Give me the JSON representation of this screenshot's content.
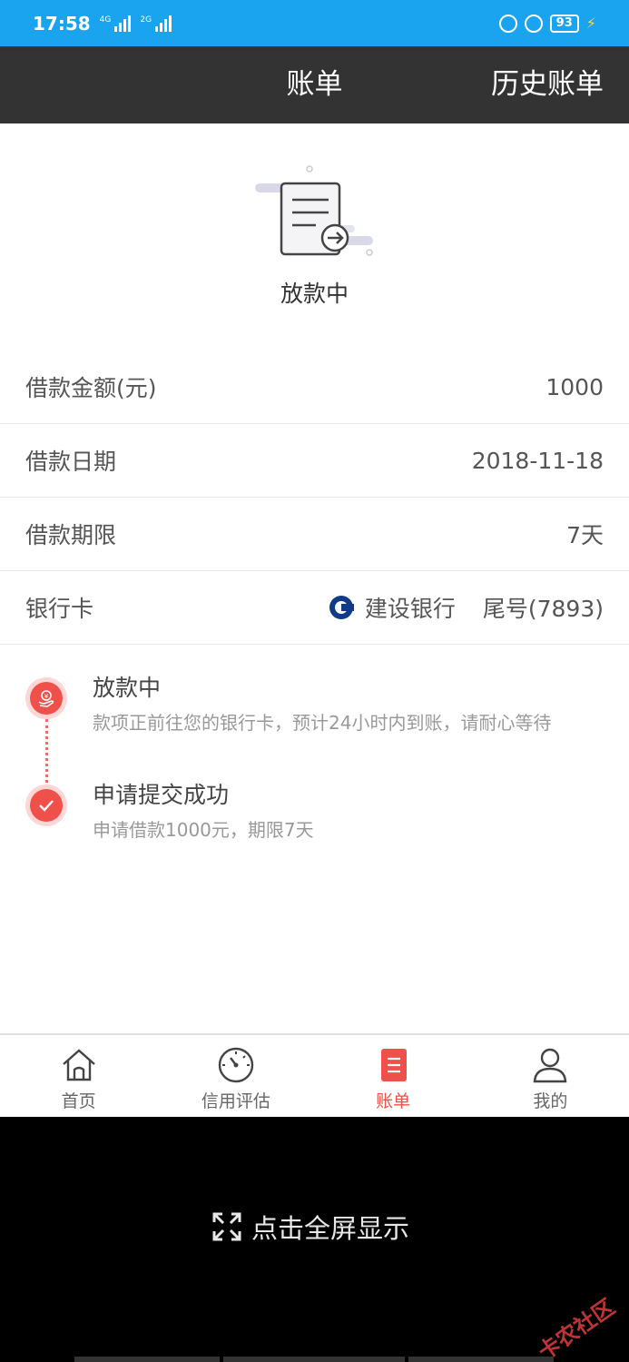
{
  "status_bar": {
    "time": "17:58",
    "network1": "4G",
    "network2": "2G",
    "battery": "93"
  },
  "header": {
    "title": "账单",
    "right_action": "历史账单"
  },
  "hero": {
    "status_title": "放款中"
  },
  "info": {
    "amount_label": "借款金额(元)",
    "amount_value": "1000",
    "date_label": "借款日期",
    "date_value": "2018-11-18",
    "term_label": "借款期限",
    "term_value": "7天",
    "bank_label": "银行卡",
    "bank_name": "建设银行",
    "card_tail": "尾号(7893)"
  },
  "timeline": [
    {
      "title": "放款中",
      "desc": "款项正前往您的银行卡，预计24小时内到账，请耐心等待"
    },
    {
      "title": "申请提交成功",
      "desc": "申请借款1000元，期限7天"
    }
  ],
  "tabbar": {
    "tabs": [
      {
        "label": "首页",
        "icon": "home-icon"
      },
      {
        "label": "信用评估",
        "icon": "gauge-icon"
      },
      {
        "label": "账单",
        "icon": "bill-icon",
        "active": true
      },
      {
        "label": "我的",
        "icon": "user-icon"
      }
    ]
  },
  "overlay": {
    "fullscreen_label": "点击全屏显示",
    "watermark": "卡农社区"
  },
  "colors": {
    "status_bar": "#1aa3ee",
    "header": "#333333",
    "accent": "#f0504a"
  }
}
